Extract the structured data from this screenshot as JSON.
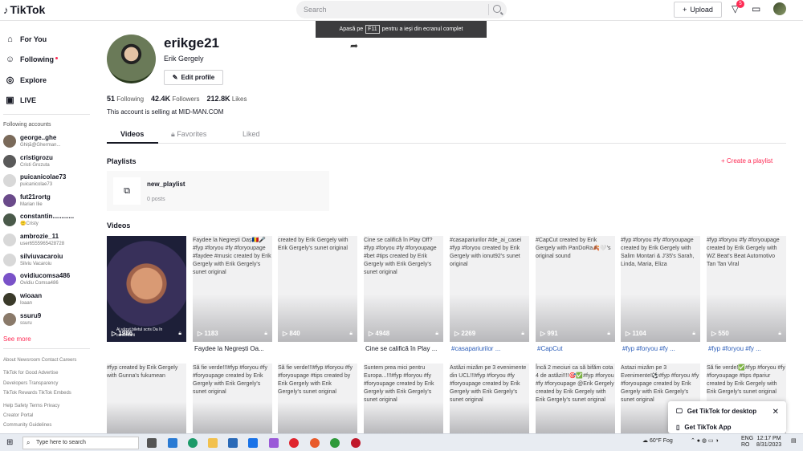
{
  "topbar": {
    "logo": "TikTok",
    "search_placeholder": "Search",
    "upload_label": "Upload",
    "notification_count": "5"
  },
  "fullscreen_hint": {
    "pre": "Apasă pe",
    "key": "F11",
    "post": "pentru a ieși din ecranul complet"
  },
  "sidebar": {
    "nav": [
      {
        "label": "For You",
        "icon": "home-icon"
      },
      {
        "label": "Following",
        "icon": "users-icon"
      },
      {
        "label": "Explore",
        "icon": "compass-icon"
      },
      {
        "label": "LIVE",
        "icon": "live-icon"
      }
    ],
    "following_title": "Following accounts",
    "accounts": [
      {
        "name": "george..ghe",
        "sub": "Ghiță@Gherman..."
      },
      {
        "name": "cristigrozu",
        "sub": "Cristi Grozuta"
      },
      {
        "name": "puicanicolae73",
        "sub": "puicanicolae73"
      },
      {
        "name": "fut21rortg",
        "sub": "Marian Ilie"
      },
      {
        "name": "constantin............",
        "sub": "🙂Cristy"
      },
      {
        "name": "ambrozie_11",
        "sub": "user6555965428728"
      },
      {
        "name": "silviuvacaroiu",
        "sub": "Silviu Vacaroiu"
      },
      {
        "name": "ovidiucomsa486",
        "sub": "Ovidiu Comsa486"
      },
      {
        "name": "wioaan",
        "sub": "Ioaan"
      },
      {
        "name": "ssuru9",
        "sub": "ssuru"
      }
    ],
    "see_more": "See more",
    "footer": [
      "About  Newsroom  Contact  Careers",
      "TikTok for Good  Advertise",
      "Developers  Transparency",
      "TikTok Rewards  TikTok Embeds",
      "Help  Safety  Terms  Privacy",
      "Creator Portal",
      "Community Guidelines"
    ]
  },
  "profile": {
    "username": "erikge21",
    "display_name": "Erik  Gergely",
    "edit_label": "Edit profile",
    "following": "51",
    "following_label": "Following",
    "followers": "42.4K",
    "followers_label": "Followers",
    "likes": "212.8K",
    "likes_label": "Likes",
    "bio": "This account is selling at MID-MAN.COM"
  },
  "tabs": [
    "Videos",
    "Favorites",
    "Liked"
  ],
  "playlists": {
    "title": "Playlists",
    "create_label": "Create a playlist",
    "item_name": "new_playlist",
    "item_count": "0 posts"
  },
  "videos_title": "Videos",
  "videos_row1": [
    {
      "text": "",
      "views": "1986",
      "caption": "",
      "overlay": "Ai văzut biletul scris Da în comentarii"
    },
    {
      "text": "Faydee la Negrești Oaș🇷🇴🎤#fyp #foryou #fy #foryoupage #faydee #music created by Erik Gergely with Erik Gergely's sunet original",
      "views": "1183",
      "caption": "Faydee la Negrești Oa..."
    },
    {
      "text": "created by Erik Gergely with Erik Gergely's sunet original",
      "views": "840",
      "caption": ""
    },
    {
      "text": "Cine se califică în Play Off?#fyp #foryou #fy #foryoupage #bet #tips created by Erik Gergely with Erik Gergely's sunet original",
      "views": "4948",
      "caption": "Cine se califică în Play ..."
    },
    {
      "text": "#casapariurilor #de_ai_casei #fyp #foryou created by Erik Gergely with ionut92's sunet original",
      "views": "2269",
      "caption": "#casapariurilor ..."
    },
    {
      "text": "#CapCut created by Erik Gergely with PanDoRa🍂🤍's original sound",
      "views": "991",
      "caption": "#CapCut"
    },
    {
      "text": "#fyp #foryou #fy #foryoupage created by Erik Gergely with Salim Montari & J'35's Sarah, Linda, Maria, Eliza",
      "views": "1104",
      "caption": "#fyp #foryou #fy ..."
    },
    {
      "text": "#fyp #foryou #fy #foryoupage created by Erik Gergely with WZ Beat's Beat Automotivo Tan Tan Viral",
      "views": "550",
      "caption": "#fyp #foryou #fy ..."
    }
  ],
  "videos_row2": [
    {
      "text": "#fyp created by Erik Gergely with Gunna's fukumean"
    },
    {
      "text": "Să fie verde!!!#fyp #foryou #fy #foryoupage created by Erik Gergely with Erik Gergely's sunet original"
    },
    {
      "text": "Să fie verde!!!#fyp #foryou #fy #foryoupage #tips created by Erik Gergely with Erik Gergely's sunet original"
    },
    {
      "text": "Suntem prea mici pentru Europa...!!!#fyp #foryou #fy #foryoupage created by Erik Gergely with Erik Gergely's sunet original"
    },
    {
      "text": "Astăzi mizăm pe 3 evenimente din UCL!!!#fyp #foryou #fy #foryoupage created by Erik Gergely with Erik Gergely's sunet original"
    },
    {
      "text": "Încă 2 meciuri ca să bifăm cota 4 de astăzi!!!!🎯✅#fyp #foryou #fy #foryoupage @Erik Gergely created by Erik Gergely with Erik Gergely's sunet original"
    },
    {
      "text": "Astazi mizăm pe 3 Evenimente!⚽#fyp #foryou #fy #foryoupage created by Erik Gergely with Erik Gergely's sunet original"
    },
    {
      "text": "Să fie verde!✅#fyp #foryou #fy #foryoupage #tips #pariur created by Erik Gergely with Erik Gergely's sunet original"
    }
  ],
  "toast": {
    "desktop": "Get TikTok for desktop",
    "app": "Get TikTok App"
  },
  "taskbar": {
    "search": "Type here to search",
    "weather": "60°F  Fog",
    "lang1": "ENG",
    "lang2": "RO",
    "time": "12:17 PM",
    "date": "8/31/2023"
  }
}
